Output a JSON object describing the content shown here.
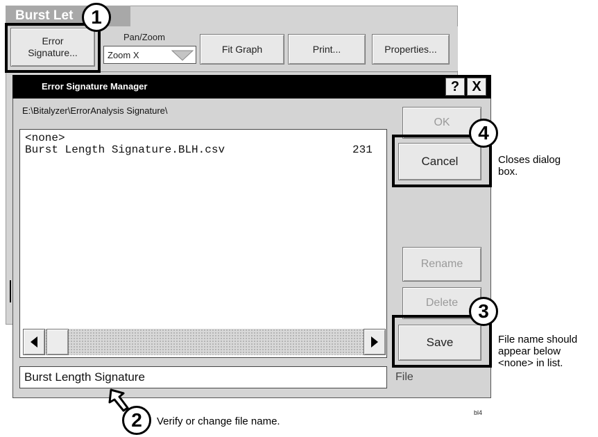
{
  "background_window": {
    "title": "Burst Let",
    "toolbar": {
      "error_signature_label": "Error Signature...",
      "pan_zoom_label": "Pan/Zoom",
      "pan_zoom_value": "Zoom X",
      "fit_graph_label": "Fit Graph",
      "print_label": "Print...",
      "properties_label": "Properties..."
    }
  },
  "dialog": {
    "title": "Error Signature Manager",
    "help_button": "?",
    "close_button": "X",
    "path": "E:\\Bitalyzer\\ErrorAnalysis Signature\\",
    "list": {
      "items": [
        {
          "name": "<none>",
          "value": ""
        },
        {
          "name": "Burst Length Signature.BLH.csv",
          "value": "231"
        }
      ]
    },
    "file_name_value": "Burst Length Signature",
    "file_label": "File",
    "buttons": {
      "ok": "OK",
      "cancel": "Cancel",
      "rename": "Rename",
      "delete": "Delete",
      "save": "Save"
    }
  },
  "callouts": {
    "numbers": [
      "1",
      "2",
      "3",
      "4"
    ],
    "cancel_note": [
      "Closes dialog",
      "box."
    ],
    "save_note": [
      "File name should",
      "appear below",
      "<none> in list."
    ],
    "name_note": "Verify or change file name."
  },
  "figure_id": "bl4"
}
